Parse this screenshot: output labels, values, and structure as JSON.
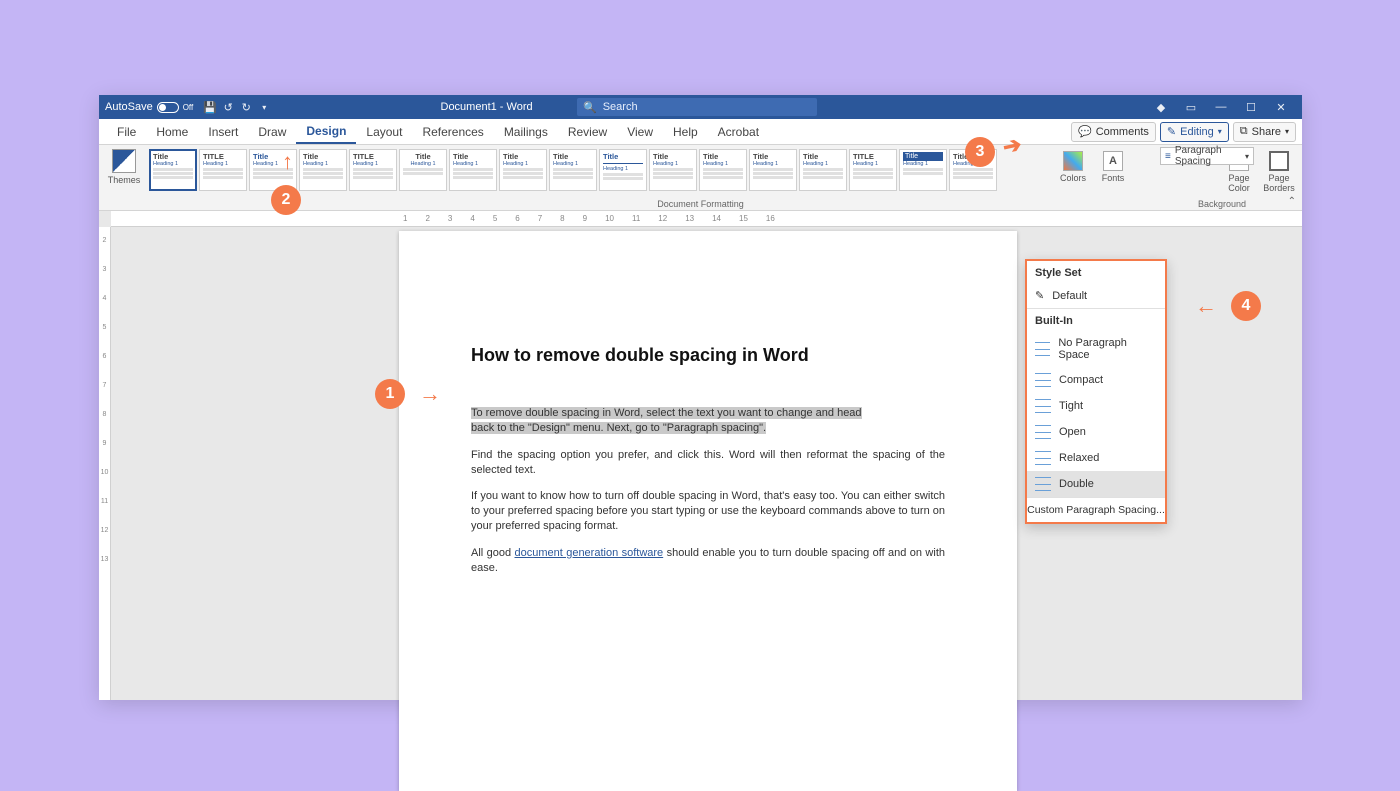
{
  "titlebar": {
    "autosave_label": "AutoSave",
    "autosave_state": "Off",
    "doc_title": "Document1 - Word",
    "search_placeholder": "Search"
  },
  "tabs": [
    "File",
    "Home",
    "Insert",
    "Draw",
    "Design",
    "Layout",
    "References",
    "Mailings",
    "Review",
    "View",
    "Help",
    "Acrobat"
  ],
  "active_tab": "Design",
  "right_pills": {
    "comments": "Comments",
    "editing": "Editing",
    "share": "Share"
  },
  "ribbon": {
    "themes": "Themes",
    "group_label": "Document Formatting",
    "colors": "Colors",
    "fonts": "Fonts",
    "paragraph_spacing": "Paragraph Spacing",
    "page_color": "Page Color",
    "page_borders": "Page Borders",
    "background_group": "Background",
    "gallery_item": {
      "title": "Title",
      "heading": "Heading 1"
    }
  },
  "dropdown": {
    "header1": "Style Set",
    "default": "Default",
    "header2": "Built-In",
    "options": [
      "No Paragraph Space",
      "Compact",
      "Tight",
      "Open",
      "Relaxed",
      "Double"
    ],
    "footer": "Custom Paragraph Spacing...",
    "highlighted": "Double"
  },
  "document": {
    "heading": "How to remove double spacing in Word",
    "p1a": "To remove double spacing in Word, select the text you want to change and head",
    "p1b": "back to the \"Design\" menu. Next, go to \"Paragraph spacing\".",
    "p2": "Find the spacing option you prefer, and click this. Word will then reformat the spacing of the selected text.",
    "p3": "If you want to know how to turn off double spacing in Word, that's easy too. You can either switch to your preferred spacing before you start typing or use the keyboard commands above to turn on your preferred spacing format.",
    "p4a": "All good ",
    "p4link": "document generation software",
    "p4b": " should enable you to turn double spacing off and on with ease."
  },
  "ruler_h": [
    "1",
    "2",
    "3",
    "4",
    "5",
    "6",
    "7",
    "8",
    "9",
    "10",
    "11",
    "12",
    "13",
    "14",
    "15",
    "16"
  ],
  "ruler_v": [
    "2",
    "3",
    "4",
    "5",
    "6",
    "7",
    "8",
    "9",
    "10",
    "11",
    "12",
    "13"
  ],
  "badges": {
    "b1": "1",
    "b2": "2",
    "b3": "3",
    "b4": "4"
  }
}
